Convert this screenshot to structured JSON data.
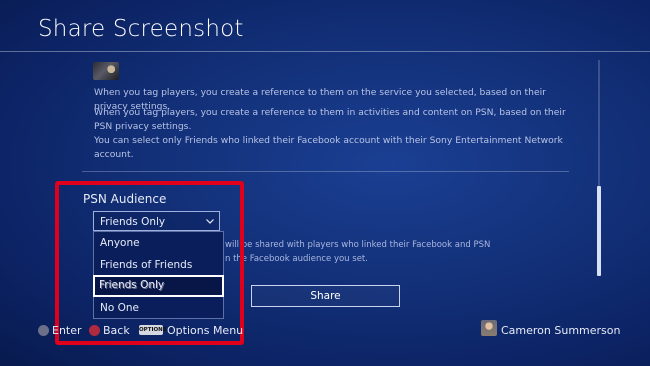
{
  "header": {
    "title": "Share Screenshot"
  },
  "info": {
    "tag_service": "When you tag players, you create a reference to them on the service you selected, based on their privacy settings.",
    "tag_psn": "When you tag players, you create a reference to them in activities and content on PSN, based on their PSN privacy settings.",
    "friends_note": "You can select only Friends who linked their Facebook account with their Sony Entertainment Network account."
  },
  "psn_audience": {
    "label": "PSN Audience",
    "selected": "Friends Only",
    "options": [
      "Anyone",
      "Friends of Friends",
      "Friends Only",
      "No One"
    ]
  },
  "behind_text": {
    "line1": "will be shared with players who linked their Facebook and PSN",
    "line2": "n the Facebook audience you set."
  },
  "share_button": "Share",
  "footer": {
    "enter": "Enter",
    "back": "Back",
    "options_icon_text": "OPTIONS",
    "options_menu": "Options Menu",
    "user_name": "Cameron Summerson"
  },
  "colors": {
    "highlight": "#e0001b",
    "background": "#13317a"
  }
}
